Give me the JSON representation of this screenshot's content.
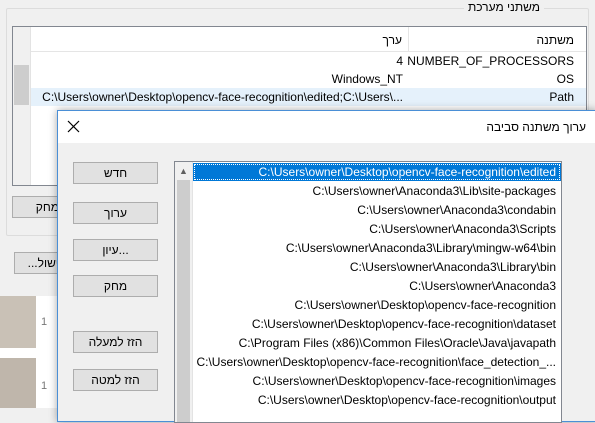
{
  "system_variables": {
    "group_label": "משתני מערכת",
    "columns": {
      "name": "משתנה",
      "value": "ערך"
    },
    "rows": [
      {
        "name": "NUMBER_OF_PROCESSORS",
        "value": "4"
      },
      {
        "name": "OS",
        "value": "Windows_NT"
      },
      {
        "name": "Path",
        "value": "C:\\Users\\owner\\Desktop\\opencv-face-recognition\\edited;C:\\Users\\..."
      }
    ],
    "buttons": {
      "delete": "מחק",
      "ok": "...ישול"
    }
  },
  "thumbnails": {
    "n1": "1",
    "n2": "1"
  },
  "edit_dialog": {
    "title": "ערוך משתנה סביבה",
    "buttons": {
      "new": "חדש",
      "edit": "ערוך",
      "browse": "עיון...",
      "delete": "מחק",
      "move_up": "הזז למעלה",
      "move_down": "הזז למטה"
    },
    "paths": [
      "C:\\Users\\owner\\Desktop\\opencv-face-recognition\\edited",
      "C:\\Users\\owner\\Anaconda3\\Lib\\site-packages",
      "C:\\Users\\owner\\Anaconda3\\condabin",
      "C:\\Users\\owner\\Anaconda3\\Scripts",
      "C:\\Users\\owner\\Anaconda3\\Library\\mingw-w64\\bin",
      "C:\\Users\\owner\\Anaconda3\\Library\\bin",
      "C:\\Users\\owner\\Anaconda3",
      "C:\\Users\\owner\\Desktop\\opencv-face-recognition",
      "C:\\Users\\owner\\Desktop\\opencv-face-recognition\\dataset",
      "C:\\Program Files (x86)\\Common Files\\Oracle\\Java\\javapath",
      "C:\\Users\\owner\\Desktop\\opencv-face-recognition\\face_detection_...",
      "C:\\Users\\owner\\Desktop\\opencv-face-recognition\\images",
      "C:\\Users\\owner\\Desktop\\opencv-face-recognition\\output"
    ],
    "selected_index": 0
  }
}
